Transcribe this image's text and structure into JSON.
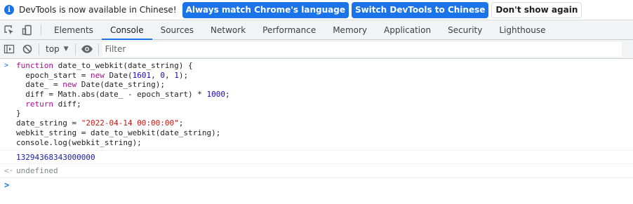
{
  "infobar": {
    "message": "DevTools is now available in Chinese!",
    "match_button": "Always match Chrome's language",
    "switch_button": "Switch DevTools to Chinese",
    "dismiss_button": "Don't show again"
  },
  "tabs": [
    "Elements",
    "Console",
    "Sources",
    "Network",
    "Performance",
    "Memory",
    "Application",
    "Security",
    "Lighthouse"
  ],
  "active_tab": "Console",
  "console_toolbar": {
    "context": "top",
    "filter_placeholder": "Filter"
  },
  "console": {
    "code_lines": [
      "function date_to_webkit(date_string) {",
      "  epoch_start = new Date(1601, 0, 1);",
      "  date_ = new Date(date_string);",
      "  diff = Math.abs(date_ - epoch_start) * 1000;",
      "  return diff;",
      "}",
      "date_string = \"2022-04-14 00:00:00\";",
      "webkit_string = date_to_webkit(date_string);",
      "console.log(webkit_string);"
    ],
    "log_output": "13294368343000000",
    "return_value": "undefined"
  },
  "colors": {
    "accent": "#1a73e8",
    "keyword": "#aa0d91",
    "string": "#c41a16",
    "number": "#1c00cf"
  }
}
